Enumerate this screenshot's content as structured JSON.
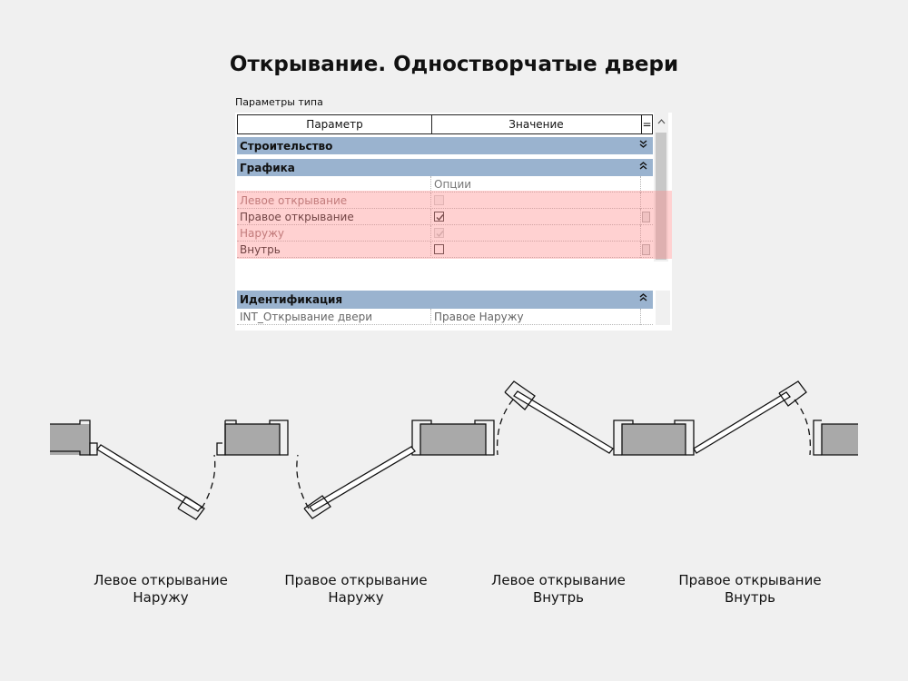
{
  "title": "Открывание. Одностворчатые двери",
  "panel": {
    "label": "Параметры типа",
    "columns": {
      "param": "Параметр",
      "value": "Значение",
      "extra": "="
    },
    "groups": {
      "construction": {
        "label": "Строительство",
        "chevron": "⌄"
      },
      "graphics": {
        "label": "Графика",
        "chevron": "⌃"
      },
      "identification": {
        "label": "Идентификация",
        "chevron": "⌃"
      }
    },
    "graphics_rows": [
      {
        "name": "",
        "value": "Опции"
      },
      {
        "name": "Левое открывание",
        "checked": false,
        "enabled": false
      },
      {
        "name": "Правое открывание",
        "checked": true,
        "enabled": true
      },
      {
        "name": "Наружу",
        "checked": true,
        "enabled": false
      },
      {
        "name": "Внутрь",
        "checked": false,
        "enabled": true
      }
    ],
    "ident_row": {
      "name": "INT_Открывание двери",
      "value": "Правое Наружу"
    },
    "highlight_color": "#ff8c8c",
    "group_color": "#9ab3cf"
  },
  "captions": [
    {
      "line1": "Левое открывание",
      "line2": "Наружу"
    },
    {
      "line1": "Правое открывание",
      "line2": "Наружу"
    },
    {
      "line1": "Левое открывание",
      "line2": "Внутрь"
    },
    {
      "line1": "Правое открывание",
      "line2": "Внутрь"
    }
  ]
}
